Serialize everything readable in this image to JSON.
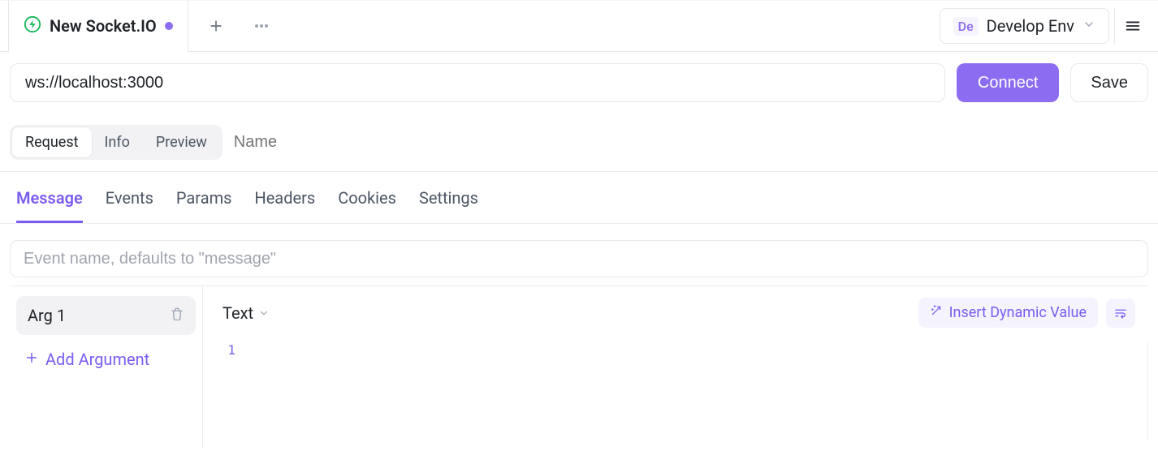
{
  "tab": {
    "title": "New Socket.IO"
  },
  "env": {
    "prefix": "De",
    "name": "Develop Env"
  },
  "url": {
    "value": "ws://localhost:3000"
  },
  "actions": {
    "connect": "Connect",
    "save": "Save"
  },
  "segmented": {
    "request": "Request",
    "info": "Info",
    "preview": "Preview"
  },
  "name_input": {
    "placeholder": "Name",
    "value": ""
  },
  "sub_tabs": {
    "message": "Message",
    "events": "Events",
    "params": "Params",
    "headers": "Headers",
    "cookies": "Cookies",
    "settings": "Settings"
  },
  "event_name": {
    "placeholder": "Event name, defaults to \"message\"",
    "value": ""
  },
  "args": {
    "items": [
      {
        "label": "Arg 1"
      }
    ],
    "add_label": "Add Argument"
  },
  "editor": {
    "format": "Text",
    "dynamic_label": "Insert Dynamic Value",
    "gutter": "1",
    "content": ""
  }
}
